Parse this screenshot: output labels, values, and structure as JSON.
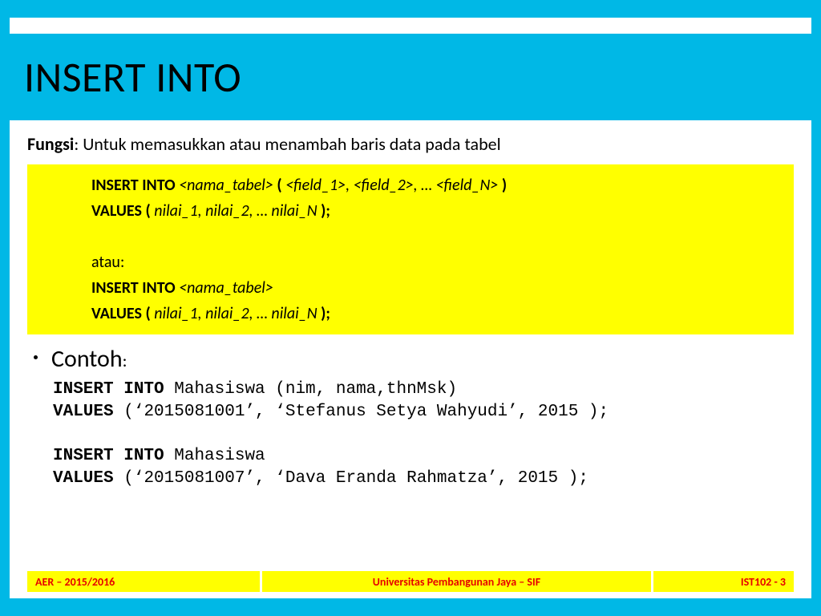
{
  "title": "INSERT INTO",
  "fungsi": {
    "label": "Fungsi",
    "text": ": Untuk memasukkan atau menambah baris data pada tabel"
  },
  "syntax": {
    "line1_a": "INSERT INTO ",
    "line1_b": "<nama_tabel> ",
    "line1_c": "( ",
    "line1_d": "<field_1>, <field_2>, … <field_N> ",
    "line1_e": ")",
    "line2_a": "VALUES ( ",
    "line2_b": "nilai_1, nilai_2, … nilai_N ",
    "line2_c": ");",
    "line3": "atau:",
    "line4_a": "INSERT INTO ",
    "line4_b": "<nama_tabel>",
    "line5_a": "VALUES ( ",
    "line5_b": "nilai_1, nilai_2, … nilai_N ",
    "line5_c": ");"
  },
  "contoh": {
    "header": "Contoh",
    "ex1_l1_a": "INSERT INTO ",
    "ex1_l1_b": "Mahasiswa (nim, nama,thnMsk)",
    "ex1_l2_a": "VALUES ",
    "ex1_l2_b": "(‘",
    "ex1_l2_c": "2015081001’, ‘Stefanus Setya Wahyudi’, 2015 );",
    "ex2_l1_a": "INSERT INTO ",
    "ex2_l1_b": "Mahasiswa",
    "ex2_l2_a": "VALUES ",
    "ex2_l2_b": "(‘",
    "ex2_l2_c": "2015081007’, ‘Dava Eranda Rahmatza’, 2015 );"
  },
  "footer": {
    "left": "AER – 2015/2016",
    "center": "Universitas Pembangunan Jaya – SIF",
    "right": "IST102 - 3"
  }
}
